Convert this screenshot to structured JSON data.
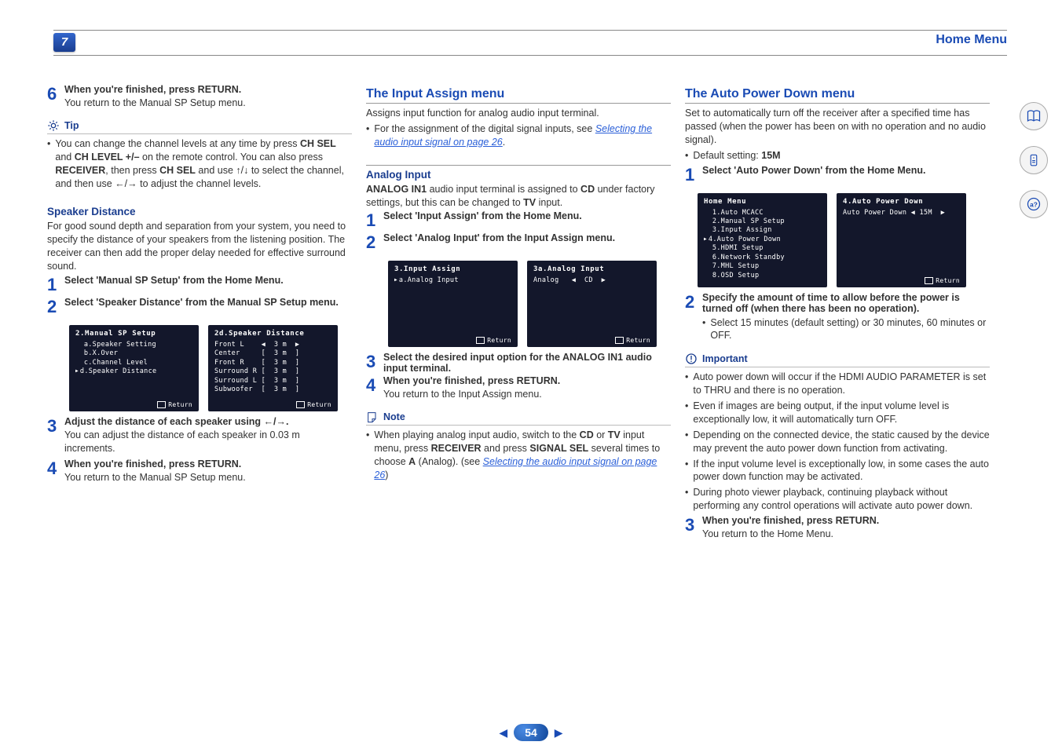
{
  "header": {
    "chapter_number": "7",
    "section_title": "Home Menu"
  },
  "page": {
    "number": "54"
  },
  "col1": {
    "step6": {
      "title_prefix": "When you're finished, press ",
      "title_button": "RETURN",
      "title_suffix": ".",
      "body": "You return to the Manual SP Setup menu."
    },
    "tip_label": "Tip",
    "tip_text_parts": [
      "You can change the channel levels at any time by press ",
      "CH SEL",
      " and ",
      "CH LEVEL +/–",
      " on the remote control. You can also press ",
      "RECEIVER",
      ", then press ",
      "CH SEL",
      " and use ",
      "/",
      " to select the channel, and then use ",
      "/",
      " to adjust the channel levels."
    ],
    "speaker_distance_heading": "Speaker Distance",
    "speaker_distance_intro": "For good sound depth and separation from your system, you need to specify the distance of your speakers from the listening position. The receiver can then add the proper delay needed for effective surround sound.",
    "sd_step1": "Select 'Manual SP Setup' from the Home Menu.",
    "sd_step2": "Select 'Speaker Distance' from the Manual SP Setup menu.",
    "osd_sp_setup": {
      "title": "2.Manual SP Setup",
      "lines": [
        "  a.Speaker Setting",
        "  b.X.Over",
        "  c.Channel Level",
        "d.Speaker Distance"
      ],
      "return": "Return"
    },
    "osd_sp_distance": {
      "title": "2d.Speaker Distance",
      "lines": [
        "Front L    ◀  3 m  ▶",
        "Center     [  3 m  ]",
        "Front R    [  3 m  ]",
        "Surround R [  3 m  ]",
        "Surround L [  3 m  ]",
        "Subwoofer  [  3 m  ]"
      ],
      "return": "Return"
    },
    "sd_step3_title": "Adjust the distance of each speaker using ←/→.",
    "sd_step3_body": "You can adjust the distance of each speaker in 0.03 m increments.",
    "sd_step4_title_prefix": "When you're finished, press ",
    "sd_step4_title_button": "RETURN",
    "sd_step4_title_suffix": ".",
    "sd_step4_body": "You return to the Manual SP Setup menu."
  },
  "col2": {
    "heading": "The Input Assign menu",
    "intro": "Assigns input function for analog audio input terminal.",
    "intro_bullet_prefix": "For the assignment of the digital signal inputs, see ",
    "intro_link": "Selecting the audio input signal",
    "intro_link_suffix": " on page 26",
    "analog_heading": "Analog Input",
    "analog_intro_a": "ANALOG IN1",
    "analog_intro_b": " audio input terminal is assigned to ",
    "analog_intro_c": "CD",
    "analog_intro_d": " under factory settings, but this can be changed to ",
    "analog_intro_e": "TV",
    "analog_intro_f": " input.",
    "step1": "Select 'Input Assign' from the Home Menu.",
    "step2": "Select 'Analog Input' from the Input Assign menu.",
    "osd_input_assign": {
      "title": "3.Input Assign",
      "a_line": "a.Analog Input",
      "return": "Return"
    },
    "osd_analog_input": {
      "title": "3a.Analog Input",
      "line": "Analog   ◀  CD  ▶",
      "return": "Return"
    },
    "step3": "Select the desired input option for the ANALOG IN1 audio input terminal.",
    "step4_title_prefix": "When you're finished, press ",
    "step4_title_button": "RETURN",
    "step4_title_suffix": ".",
    "step4_body": "You return to the Input Assign menu.",
    "note_label": "Note",
    "note_parts": [
      "When playing analog input audio, switch to the ",
      "CD",
      " or ",
      "TV",
      " input menu, press ",
      "RECEIVER",
      " and press ",
      "SIGNAL SEL",
      " several times to choose ",
      "A",
      " (Analog). (see "
    ],
    "note_link": "Selecting the audio input signal",
    "note_link_suffix": " on page 26",
    "note_close": ")"
  },
  "col3": {
    "heading": "The Auto Power Down menu",
    "intro": "Set to automatically turn off the receiver after a specified time has passed (when the power has been on with no operation and no audio signal).",
    "default_prefix": "Default setting: ",
    "default_value": "15M",
    "step1": "Select 'Auto Power Down' from the Home Menu.",
    "osd_home": {
      "title": "Home Menu",
      "lines": [
        "  1.Auto MCACC",
        "  2.Manual SP Setup",
        "  3.Input Assign",
        "4.Auto Power Down",
        "  5.HDMI Setup",
        "  6.Network Standby",
        "  7.MHL Setup",
        "  8.OSD Setup"
      ]
    },
    "osd_apd": {
      "title": "4.Auto Power Down",
      "line": "Auto Power Down ◀ 15M  ▶",
      "return": "Return"
    },
    "step2_title": "Specify the amount of time to allow before the power is turned off (when there has been no operation).",
    "step2_body": "Select 15 minutes (default setting) or 30 minutes, 60 minutes or OFF.",
    "important_label": "Important",
    "important_bullets": [
      "Auto power down will occur if the HDMI AUDIO PARAMETER is set to THRU and there is no operation.",
      "Even if images are being output, if the input volume level is exceptionally low, it will automatically turn OFF.",
      "Depending on the connected device, the static caused by the device may prevent the auto power down function from activating.",
      "If the input volume level is exceptionally low, in some cases the auto power down function may be activated.",
      "During photo viewer playback, continuing playback without performing any control operations will activate auto power down."
    ],
    "step3_title_prefix": "When you're finished, press ",
    "step3_title_button": "RETURN",
    "step3_title_suffix": ".",
    "step3_body": "You return to the Home Menu."
  }
}
